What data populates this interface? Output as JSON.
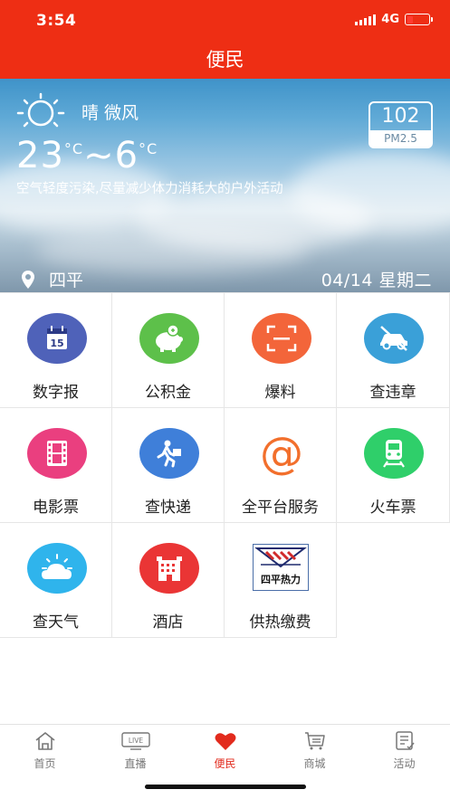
{
  "status_bar": {
    "time": "3:54",
    "network": "4G"
  },
  "header": {
    "title": "便民"
  },
  "weather": {
    "condition": "晴 微风",
    "temp_high": "23",
    "temp_low": "6",
    "temp_unit": "°C",
    "temp_sep": "~",
    "advice": "空气轻度污染,尽量减少体力消耗大的户外活动",
    "pm_value": "102",
    "pm_label": "PM2.5",
    "location": "四平",
    "date": "04/14 星期二"
  },
  "services": [
    {
      "label": "数字报",
      "icon": "calendar-icon",
      "color": "#4f62b9"
    },
    {
      "label": "公积金",
      "icon": "piggy-bank-icon",
      "color": "#5dc04a"
    },
    {
      "label": "爆料",
      "icon": "scan-icon",
      "color": "#f3653a"
    },
    {
      "label": "查违章",
      "icon": "no-car-icon",
      "color": "#3aa0d8"
    },
    {
      "label": "电影票",
      "icon": "film-icon",
      "color": "#ea3f7f"
    },
    {
      "label": "查快递",
      "icon": "courier-icon",
      "color": "#3f7fd9"
    },
    {
      "label": "全平台服务",
      "icon": "at-icon",
      "color": "#f26f2c"
    },
    {
      "label": "火车票",
      "icon": "train-icon",
      "color": "#2fcf6a"
    },
    {
      "label": "查天气",
      "icon": "weather-icon",
      "color": "#2fb4ec"
    },
    {
      "label": "酒店",
      "icon": "hotel-icon",
      "color": "#ea3535"
    },
    {
      "label": "供热缴费",
      "icon": "siping-heating-logo",
      "logo_text": "四平热力"
    }
  ],
  "tabs": [
    {
      "label": "首页",
      "icon": "home-icon"
    },
    {
      "label": "直播",
      "icon": "live-icon",
      "icon_text": "LIVE"
    },
    {
      "label": "便民",
      "icon": "heart-icon",
      "active": true
    },
    {
      "label": "商城",
      "icon": "shop-icon"
    },
    {
      "label": "活动",
      "icon": "activity-icon"
    }
  ],
  "colors": {
    "brand": "#ee2e14",
    "active_tab": "#e22b1d"
  }
}
